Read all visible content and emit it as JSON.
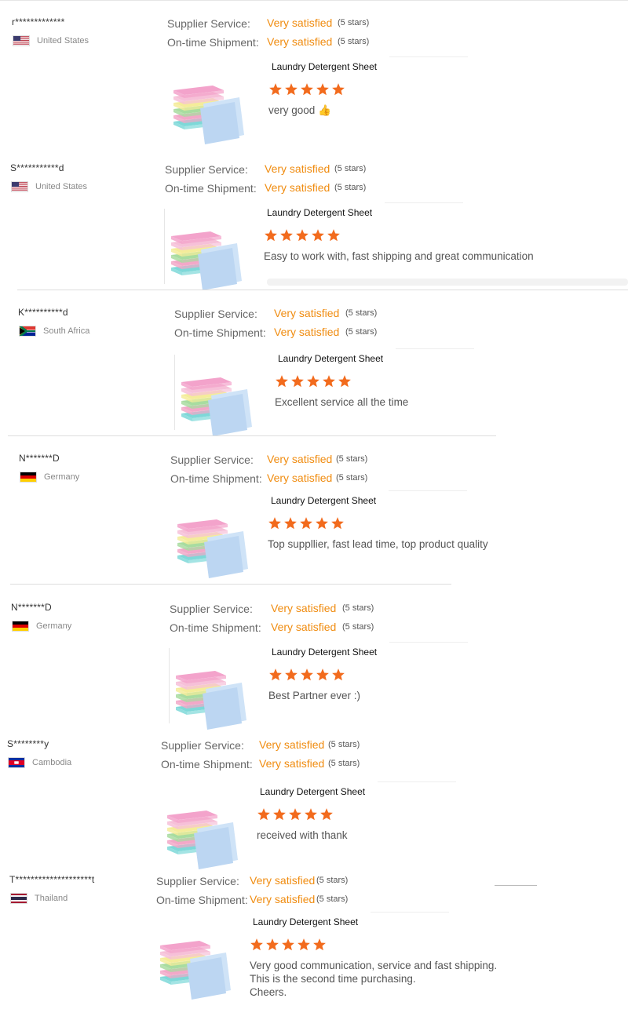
{
  "labels": {
    "supplier_service": "Supplier Service:",
    "on_time_shipment": "On-time Shipment:"
  },
  "colors": {
    "accent_orange": "#f08c10",
    "star_orange": "#f26b1d",
    "muted_text": "#888888"
  },
  "icons": {
    "star": "star-icon",
    "thumbs_up": "thumbs-up-emoji"
  },
  "reviews": [
    {
      "name": "r*************",
      "country": "United States",
      "flag": "us",
      "supplier_rating": "Very satisfied",
      "supplier_stars": "(5 stars)",
      "shipment_rating": "Very satisfied",
      "shipment_stars": "(5 stars)",
      "product": "Laundry Detergent Sheet",
      "stars": 5,
      "comment": [
        "very good 👍"
      ]
    },
    {
      "name": "S***********d",
      "country": "United States",
      "flag": "us",
      "supplier_rating": "Very satisfied",
      "supplier_stars": "(5 stars)",
      "shipment_rating": "Very satisfied",
      "shipment_stars": "(5 stars)",
      "product": "Laundry Detergent Sheet",
      "stars": 5,
      "comment": [
        "Easy to work with, fast shipping and great communication"
      ]
    },
    {
      "name": "K**********d",
      "country": "South Africa",
      "flag": "za",
      "supplier_rating": "Very satisfied",
      "supplier_stars": "(5 stars)",
      "shipment_rating": "Very satisfied",
      "shipment_stars": "(5 stars)",
      "product": "Laundry Detergent Sheet",
      "stars": 5,
      "comment": [
        "Excellent service all the time"
      ]
    },
    {
      "name": "N*******D",
      "country": "Germany",
      "flag": "de",
      "supplier_rating": "Very satisfied",
      "supplier_stars": "(5 stars)",
      "shipment_rating": "Very satisfied",
      "shipment_stars": "(5 stars)",
      "product": "Laundry Detergent Sheet",
      "stars": 5,
      "comment": [
        "Top suppllier, fast lead time, top product quality"
      ]
    },
    {
      "name": "N*******D",
      "country": "Germany",
      "flag": "de",
      "supplier_rating": "Very satisfied",
      "supplier_stars": "(5 stars)",
      "shipment_rating": "Very satisfied",
      "shipment_stars": "(5 stars)",
      "product": "Laundry Detergent Sheet",
      "stars": 5,
      "comment": [
        "Best Partner ever :)"
      ]
    },
    {
      "name": "S********y",
      "country": "Cambodia",
      "flag": "kh",
      "supplier_rating": "Very satisfied",
      "supplier_stars": "(5 stars)",
      "shipment_rating": "Very satisfied",
      "shipment_stars": "(5 stars)",
      "product": "Laundry Detergent Sheet",
      "stars": 5,
      "comment": [
        "received with thank"
      ]
    },
    {
      "name": "T********************t",
      "country": "Thailand",
      "flag": "th",
      "supplier_rating": "Very satisfied",
      "supplier_stars": "(5 stars)",
      "shipment_rating": "Very satisfied",
      "shipment_stars": "(5 stars)",
      "product": "Laundry Detergent Sheet",
      "stars": 5,
      "comment": [
        "Very good communication, service and fast shipping.",
        "This is the second time purchasing.",
        "Cheers."
      ]
    }
  ]
}
